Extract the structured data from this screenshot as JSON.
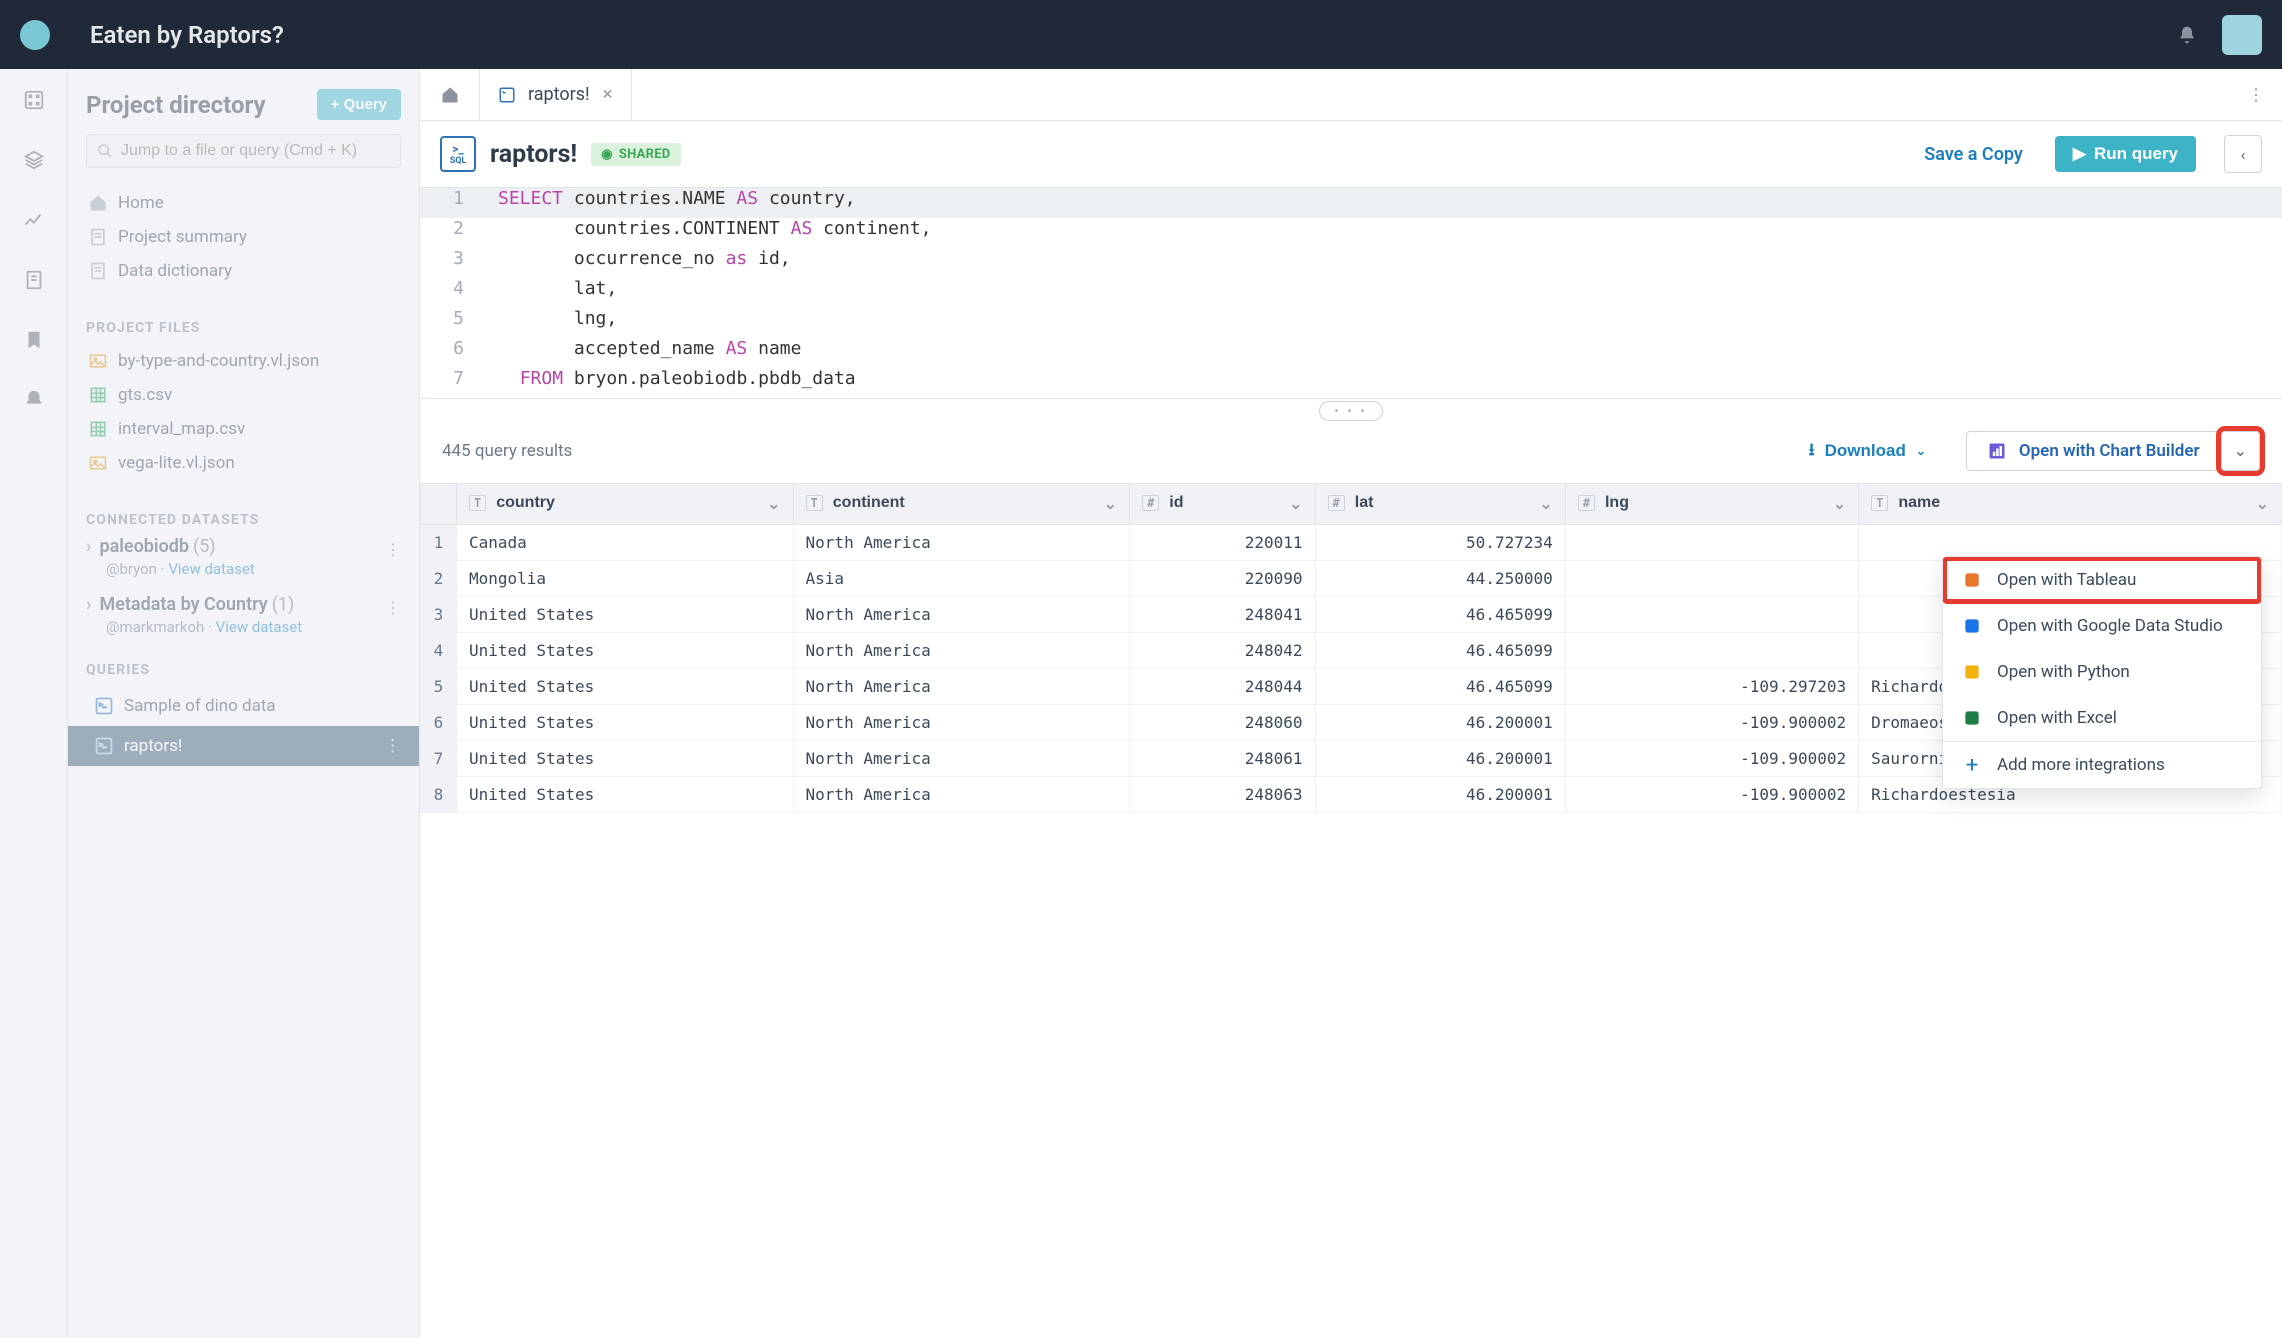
{
  "header": {
    "title": "Eaten by Raptors?"
  },
  "sidebar": {
    "heading": "Project directory",
    "new_query_label": "+ Query",
    "search_placeholder": "Jump to a file or query (Cmd + K)",
    "nav": [
      {
        "label": "Home"
      },
      {
        "label": "Project summary"
      },
      {
        "label": "Data dictionary"
      }
    ],
    "sections": {
      "files_label": "PROJECT FILES",
      "datasets_label": "CONNECTED DATASETS",
      "queries_label": "QUERIES"
    },
    "files": [
      {
        "label": "by-type-and-country.vl.json",
        "icon": "img"
      },
      {
        "label": "gts.csv",
        "icon": "csv"
      },
      {
        "label": "interval_map.csv",
        "icon": "csv"
      },
      {
        "label": "vega-lite.vl.json",
        "icon": "img"
      }
    ],
    "datasets": [
      {
        "name": "paleobiodb",
        "count": "(5)",
        "owner": "@bryon",
        "view": "View dataset"
      },
      {
        "name": "Metadata by Country",
        "count": "(1)",
        "owner": "@markmarkoh",
        "view": "View dataset"
      }
    ],
    "queries": [
      {
        "label": "Sample of dino data",
        "active": false
      },
      {
        "label": "raptors!",
        "active": true
      }
    ]
  },
  "tabs": {
    "active": {
      "label": "raptors!"
    }
  },
  "editor": {
    "title": "raptors!",
    "shared_label": "SHARED",
    "save_copy": "Save a Copy",
    "run_label": "Run query",
    "lines": [
      {
        "n": "1",
        "pre": "",
        "kw": "SELECT",
        "mid": " countries.NAME ",
        "as": "AS",
        "post": " country,"
      },
      {
        "n": "2",
        "pre": "       ",
        "kw": "",
        "mid": "countries.CONTINENT ",
        "as": "AS",
        "post": " continent,"
      },
      {
        "n": "3",
        "pre": "       ",
        "kw": "",
        "mid": "occurrence_no ",
        "as": "as",
        "post": " id,"
      },
      {
        "n": "4",
        "pre": "       ",
        "kw": "",
        "mid": "lat,",
        "as": "",
        "post": ""
      },
      {
        "n": "5",
        "pre": "       ",
        "kw": "",
        "mid": "lng,",
        "as": "",
        "post": ""
      },
      {
        "n": "6",
        "pre": "       ",
        "kw": "",
        "mid": "accepted_name ",
        "as": "AS",
        "post": " name"
      },
      {
        "n": "7",
        "pre": "  ",
        "kw": "FROM",
        "mid": " bryon.paleobiodb.pbdb_data",
        "as": "",
        "post": ""
      }
    ]
  },
  "results": {
    "count_label": "445 query results",
    "download_label": "Download",
    "open_cb_label": "Open with Chart Builder"
  },
  "dropdown": {
    "items": [
      {
        "label": "Open with Tableau",
        "color": "#e8762d"
      },
      {
        "label": "Open with Google Data Studio",
        "color": "#1a73e8"
      },
      {
        "label": "Open with Python",
        "color": "#f2b10f"
      },
      {
        "label": "Open with Excel",
        "color": "#1e7e45"
      }
    ],
    "add_label": "Add more integrations"
  },
  "table": {
    "columns": [
      {
        "name": "country",
        "type": "T"
      },
      {
        "name": "continent",
        "type": "T"
      },
      {
        "name": "id",
        "type": "#"
      },
      {
        "name": "lat",
        "type": "#"
      },
      {
        "name": "lng",
        "type": "#"
      },
      {
        "name": "name",
        "type": "T"
      }
    ],
    "rows": [
      {
        "n": "1",
        "cells": [
          "Canada",
          "North America",
          "220011",
          "50.727234",
          "",
          ""
        ]
      },
      {
        "n": "2",
        "cells": [
          "Mongolia",
          "Asia",
          "220090",
          "44.250000",
          "",
          ""
        ]
      },
      {
        "n": "3",
        "cells": [
          "United States",
          "North America",
          "248041",
          "46.465099",
          "",
          ""
        ]
      },
      {
        "n": "4",
        "cells": [
          "United States",
          "North America",
          "248042",
          "46.465099",
          "",
          ""
        ]
      },
      {
        "n": "5",
        "cells": [
          "United States",
          "North America",
          "248044",
          "46.465099",
          "-109.297203",
          "Richardoestesia"
        ]
      },
      {
        "n": "6",
        "cells": [
          "United States",
          "North America",
          "248060",
          "46.200001",
          "-109.900002",
          "Dromaeosaurus"
        ]
      },
      {
        "n": "7",
        "cells": [
          "United States",
          "North America",
          "248061",
          "46.200001",
          "-109.900002",
          "Saurornitholestes"
        ]
      },
      {
        "n": "8",
        "cells": [
          "United States",
          "North America",
          "248063",
          "46.200001",
          "-109.900002",
          "Richardoestesia"
        ]
      }
    ]
  }
}
